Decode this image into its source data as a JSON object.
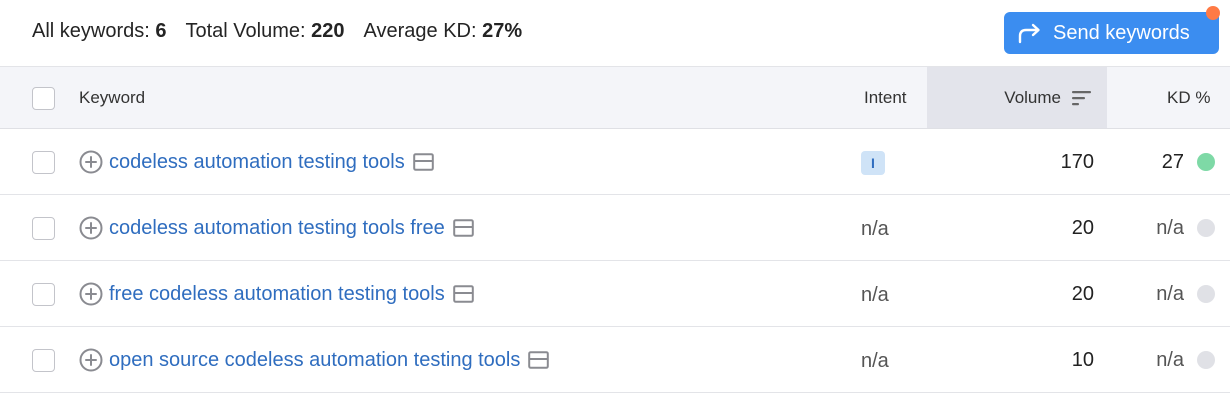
{
  "summary": {
    "all_keywords_label": "All keywords:",
    "all_keywords_value": "6",
    "total_volume_label": "Total Volume:",
    "total_volume_value": "220",
    "average_kd_label": "Average KD:",
    "average_kd_value": "27%"
  },
  "send_button": {
    "label": "Send keywords",
    "icon": "share-arrow-icon",
    "notification_color": "#ff7a45",
    "color": "#3b8df0"
  },
  "table": {
    "columns": {
      "keyword": "Keyword",
      "intent": "Intent",
      "volume": "Volume",
      "kd": "KD %"
    },
    "sorted_by": "Volume",
    "rows": [
      {
        "keyword": "codeless automation testing tools",
        "intent": "I",
        "volume": "170",
        "kd": "27",
        "kd_color": "#7ed9a6"
      },
      {
        "keyword": "codeless automation testing tools free",
        "intent": "n/a",
        "volume": "20",
        "kd": "n/a",
        "kd_color": "#e0e1e6"
      },
      {
        "keyword": "free codeless automation testing tools",
        "intent": "n/a",
        "volume": "20",
        "kd": "n/a",
        "kd_color": "#e0e1e6"
      },
      {
        "keyword": "open source codeless automation testing tools",
        "intent": "n/a",
        "volume": "10",
        "kd": "n/a",
        "kd_color": "#e0e1e6"
      }
    ]
  }
}
